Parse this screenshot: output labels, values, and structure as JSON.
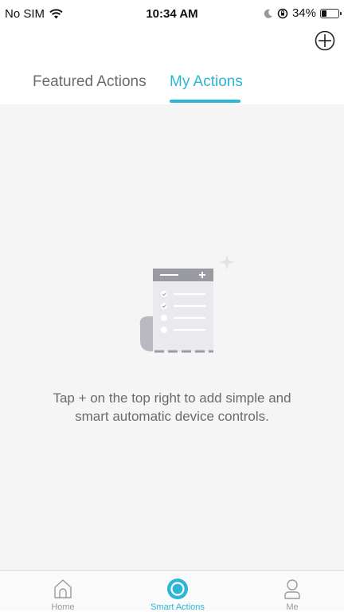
{
  "status_bar": {
    "carrier": "No SIM",
    "time": "10:34 AM",
    "battery_percent": "34%",
    "battery_level": 0.34
  },
  "header": {
    "add_icon": "plus-circle-icon"
  },
  "tabs": [
    {
      "label": "Featured Actions",
      "active": false
    },
    {
      "label": "My Actions",
      "active": true
    }
  ],
  "empty_state": {
    "illustration": "document-checklist-icon",
    "message_line1": "Tap + on the top right to add simple and",
    "message_line2": "smart automatic device controls."
  },
  "tab_bar": {
    "items": [
      {
        "label": "Home",
        "icon": "home-icon",
        "active": false
      },
      {
        "label": "Smart Actions",
        "icon": "smart-actions-icon",
        "active": true
      },
      {
        "label": "Me",
        "icon": "person-icon",
        "active": false
      }
    ]
  },
  "colors": {
    "accent": "#2bb5d6",
    "inactive_text": "#6b6b6b",
    "content_background": "#f5f5f6"
  }
}
